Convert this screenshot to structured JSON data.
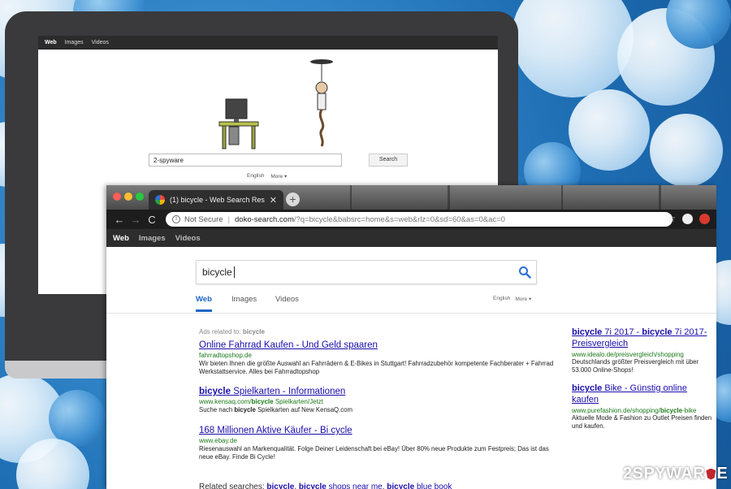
{
  "monitor": {
    "nav": [
      "Web",
      "Images",
      "Videos"
    ],
    "search_value": "2-spyware",
    "search_button": "Search",
    "lang": "English",
    "more": "More ▾"
  },
  "browser": {
    "tab_title": "(1) bicycle - Web Search Resu",
    "tab_close": "✕",
    "new_tab": "+",
    "nav_back": "←",
    "nav_forward": "→",
    "nav_reload": "C",
    "info_icon": "i",
    "not_secure": "Not Secure",
    "separator": "|",
    "url_host": "doko-search.com",
    "url_rest": "/?q=bicycle&babsrc=home&s=web&rlz=0&sd=60&as=0&ac=0",
    "star": "☆"
  },
  "site_nav": [
    "Web",
    "Images",
    "Videos"
  ],
  "search": {
    "value": "bicycle"
  },
  "result_tabs": [
    "Web",
    "Images",
    "Videos"
  ],
  "lang": {
    "label": "English",
    "more": "More ▾"
  },
  "ads_label": "Ads related to:",
  "ads_query": "bicycle",
  "results": [
    {
      "title": "Online Fahrrad Kaufen - Und Geld spaaren",
      "url": "fahrradtopshop.de",
      "desc": "Wir bieten Ihnen die größte Auswahl an Fahrrädern & E-Bikes in Stuttgart! Fahrradzubehör kompetente Fachberater + Fahrrad Werkstattservice. Alles bei Fahrradtopshop"
    },
    {
      "title_bold": "bicycle",
      "title_rest": " Spielkarten - Informationen",
      "url_pre": "www.kensaq.com/",
      "url_bold": "bicycle",
      "url_post": " Spielkarten/Jetzt",
      "desc_pre": "Suche nach ",
      "desc_bold": "bicycle",
      "desc_post": " Spielkarten auf New KensaQ.com"
    },
    {
      "title": "168 Millionen Aktive Käufer - Bi cycle",
      "url": "www.ebay.de",
      "desc": "Riesenauswahl an Markenqualität. Folge Deiner Leidenschaft bei eBay! Über 80% neue Produkte zum Festpreis; Das ist das neue eBay. Finde Bi Cycle!"
    }
  ],
  "side_results": [
    {
      "t1": "bicycle",
      "t2": " 7i 2017 - ",
      "t3": "bicycle",
      "t4": " 7i 2017-Preisvergleich",
      "url": "www.idealo.de/preisvergleich/shopping",
      "desc": "Deutschlands größter Preisvergleich mit über 53.000 Online-Shops!"
    },
    {
      "t1": "bicycle",
      "t2": " Bike - Günstig online kaufen",
      "url_pre": "www.purefashion.de/shopping/",
      "url_bold": "bicycle",
      "url_post": "-bike",
      "desc": "Aktuelle Mode & Fashion zu Outlet Preisen finden und kaufen."
    }
  ],
  "related": {
    "label": "Related searches:",
    "l1": "bicycle",
    "sep": ",",
    "l2a": "bicycle",
    "l2b": " shops near me",
    "l3a": "bicycle",
    "l3b": " blue book"
  },
  "watermark": {
    "pre": "2SPYWAR",
    "post": "E"
  },
  "colors": {
    "link": "#1a0dab",
    "url": "#1a7a1a",
    "accent": "#1f66c4"
  }
}
